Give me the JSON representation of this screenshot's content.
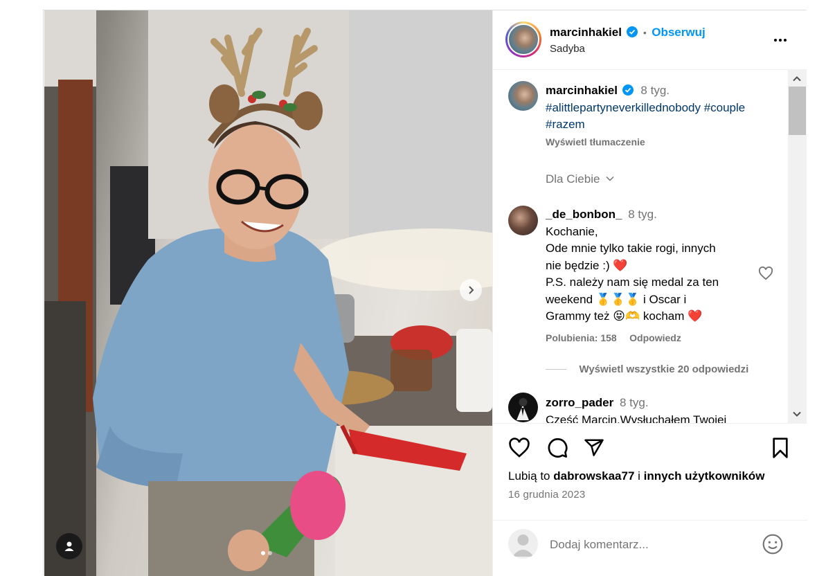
{
  "post": {
    "author": "marcinhakiel",
    "separator": "•",
    "follow_label": "Obserwuj",
    "location": "Sadyba",
    "more_icon": "more-horizontal-icon"
  },
  "caption": {
    "author": "marcinhakiel",
    "time": "8 tyg.",
    "hashtags_line1": "#alittlepartyneverkillednobody #couple",
    "hashtags_line2": "#razem",
    "translate_label": "Wyświetl tłumaczenie"
  },
  "filter": {
    "label": "Dla Ciebie"
  },
  "comments": [
    {
      "author": "_de_bonbon_",
      "time": "8 tyg.",
      "lines": [
        "Kochanie,",
        "Ode mnie tylko takie rogi, innych",
        "nie będzie :) ❤️",
        "P.S. należy nam się medal za ten",
        "weekend 🥇🥇🥇 i Oscar i",
        "Grammy też 😝🫶 kocham ❤️"
      ],
      "likes_label": "Polubienia: 158",
      "reply_label": "Odpowiedz",
      "view_replies_label": "Wyświetl wszystkie 20 odpowiedzi"
    },
    {
      "author": "zorro_pader",
      "time": "8 tyg.",
      "lines": [
        "Cześć Marcin.Wysłuchałem Twojej"
      ]
    }
  ],
  "actions": {
    "likes_prefix": "Lubią to",
    "likes_user": "dabrowskaa77",
    "likes_mid": "i",
    "likes_others": "innych użytkowników",
    "date": "16 grudnia 2023"
  },
  "add_comment": {
    "placeholder": "Dodaj komentarz..."
  },
  "colors": {
    "accent": "#0095f6",
    "hashtag": "#00376b",
    "muted": "#737373",
    "border": "#dbdbdb"
  }
}
